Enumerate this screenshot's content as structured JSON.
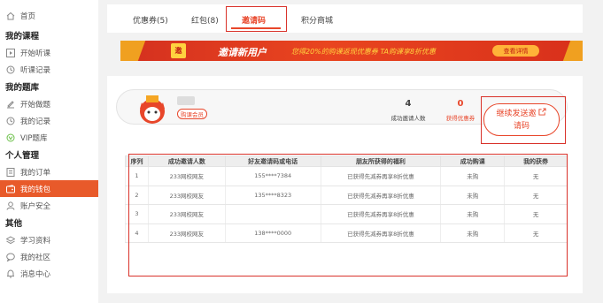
{
  "sidebar": {
    "home": "首页",
    "sections": [
      {
        "title": "我的课程",
        "items": [
          "开始听课",
          "听课记录"
        ]
      },
      {
        "title": "我的题库",
        "items": [
          "开始做题",
          "我的记录",
          "VIP题库"
        ]
      },
      {
        "title": "个人管理",
        "items": [
          "我的订单",
          "我的钱包",
          "账户安全"
        ]
      },
      {
        "title": "其他",
        "items": [
          "学习资料",
          "我的社区",
          "消息中心"
        ]
      }
    ],
    "active_item": "我的钱包"
  },
  "tabs": [
    "优惠券(5)",
    "红包(8)",
    "邀请码",
    "积分商城"
  ],
  "active_tab": "邀请码",
  "banner": {
    "badge": "邀",
    "title": "邀请新用户",
    "subtitle": "您得20%的购课返现优惠券 TA购课享8折优惠",
    "button": "查看详情"
  },
  "profile": {
    "vip_label": "购课会员",
    "invited_count": "4",
    "invited_label": "成功邀请人数",
    "coupon_count": "0",
    "coupon_label": "获得优惠券",
    "invite_button_line1": "继续发送邀",
    "invite_button_line2": "请码"
  },
  "table": {
    "headers": [
      "序列",
      "成功邀请人数",
      "好友邀请码或电话",
      "朋友所获得的福利",
      "成功购课",
      "我的获券"
    ],
    "rows": [
      [
        "1",
        "233网校网友",
        "155****7384",
        "已获得先减券再享8折优惠",
        "未购",
        "无"
      ],
      [
        "2",
        "233网校网友",
        "135****8323",
        "已获得先减券再享8折优惠",
        "未购",
        "无"
      ],
      [
        "3",
        "233网校网友",
        "",
        "已获得先减券再享8折优惠",
        "未购",
        "无"
      ],
      [
        "4",
        "233网校网友",
        "138****0000",
        "已获得先减券再享8折优惠",
        "未购",
        "无"
      ]
    ]
  },
  "colors": {
    "accent": "#e8462a",
    "highlight": "#d9322a",
    "banner": "#d4301f"
  }
}
